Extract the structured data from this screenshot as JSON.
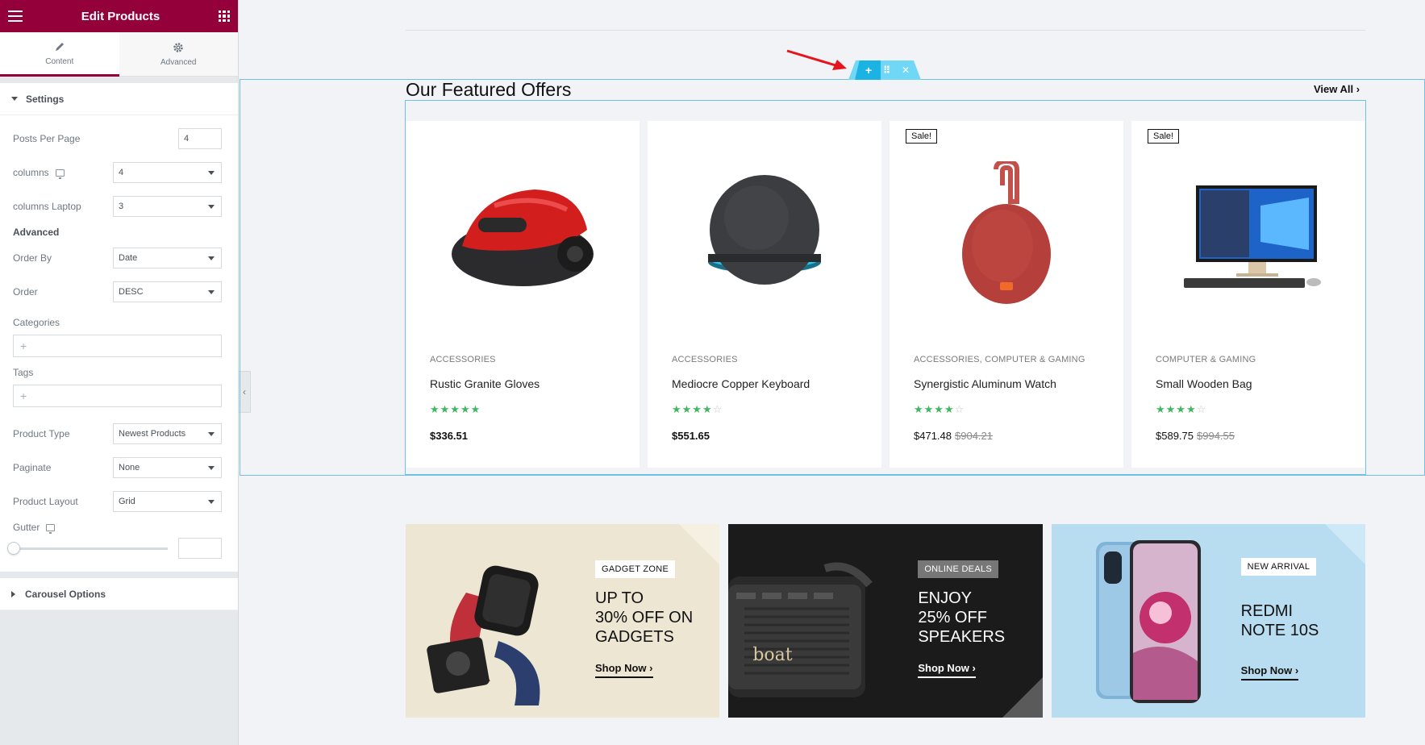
{
  "panel": {
    "title": "Edit Products",
    "tabs": [
      {
        "label": "Content",
        "icon": "pencil-icon"
      },
      {
        "label": "Advanced",
        "icon": "gear-icon"
      }
    ],
    "settings_title": "Settings",
    "posts_per_page": {
      "label": "Posts Per Page",
      "value": "4"
    },
    "columns": {
      "label": "columns",
      "value": "4"
    },
    "columns_laptop": {
      "label": "columns Laptop",
      "value": "3"
    },
    "advanced_heading": "Advanced",
    "order_by": {
      "label": "Order By",
      "value": "Date"
    },
    "order": {
      "label": "Order",
      "value": "DESC"
    },
    "categories": {
      "label": "Categories",
      "add": "+"
    },
    "tags": {
      "label": "Tags",
      "add": "+"
    },
    "product_type": {
      "label": "Product Type",
      "value": "Newest Products"
    },
    "paginate": {
      "label": "Paginate",
      "value": "None"
    },
    "product_layout": {
      "label": "Product Layout",
      "value": "Grid"
    },
    "gutter": {
      "label": "Gutter",
      "value": ""
    },
    "carousel_title": "Carousel Options",
    "collapse_icon": "‹"
  },
  "handle": {
    "add": "+",
    "move": "⠿",
    "close": "✕"
  },
  "featured": {
    "title": "Our Featured Offers",
    "view_all": "View All ›"
  },
  "products": [
    {
      "sale": "",
      "category": "ACCESSORIES",
      "name": "Rustic Granite Gloves",
      "rating": 4.5,
      "stars_on": "★★★★★",
      "stars_off": "",
      "price": "$336.51",
      "old_price": ""
    },
    {
      "sale": "",
      "category": "ACCESSORIES",
      "name": "Mediocre Copper Keyboard",
      "rating": 4.5,
      "stars_on": "★★★★",
      "stars_off": "☆",
      "price": "$551.65",
      "old_price": ""
    },
    {
      "sale": "Sale!",
      "category": "ACCESSORIES, COMPUTER & GAMING",
      "name": "Synergistic Aluminum Watch",
      "rating": 4,
      "stars_on": "★★★★",
      "stars_off": "☆",
      "price": "$471.48",
      "old_price": "$904.21"
    },
    {
      "sale": "Sale!",
      "category": "COMPUTER & GAMING",
      "name": "Small Wooden Bag",
      "rating": 4.5,
      "stars_on": "★★★★",
      "stars_off": "☆",
      "price": "$589.75",
      "old_price": "$994.55"
    }
  ],
  "banners": [
    {
      "badge": "GADGET ZONE",
      "line1": "UP TO",
      "line2": "30% OFF ON",
      "line3": "GADGETS",
      "cta": "Shop Now ›"
    },
    {
      "badge": "ONLINE DEALS",
      "line1": "ENJOY",
      "line2": "25% OFF",
      "line3": "SPEAKERS",
      "cta": "Shop Now ›",
      "logo": "boat"
    },
    {
      "badge": "NEW ARRIVAL",
      "line1": "REDMI",
      "line2": "NOTE 10S",
      "cta": "Shop Now ›"
    }
  ],
  "colors": {
    "brand": "#93003a",
    "accent": "#e8264a",
    "star": "#3fb65f",
    "outline": "#6ec1e4"
  }
}
